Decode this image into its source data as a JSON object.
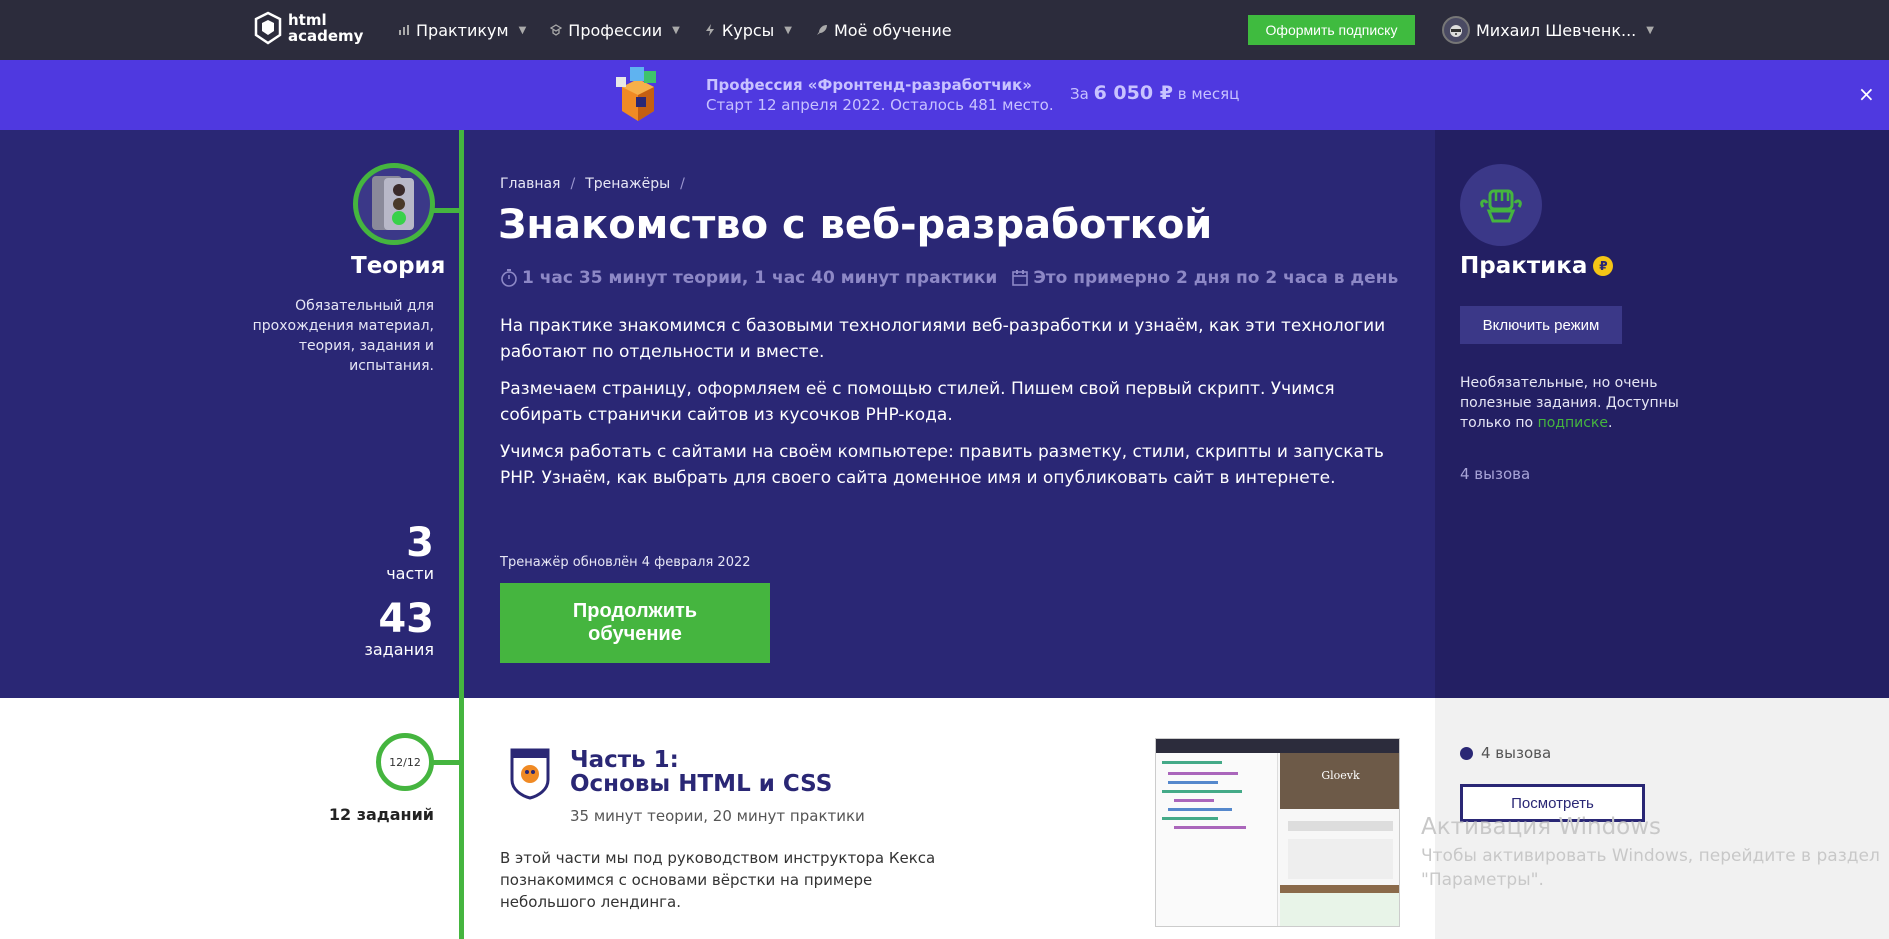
{
  "nav": {
    "logo_line1": "html",
    "logo_line2": "academy",
    "items": [
      {
        "label": "Практикум",
        "icon": "chart-icon",
        "caret": true
      },
      {
        "label": "Профессии",
        "icon": "cap-icon",
        "caret": true
      },
      {
        "label": "Курсы",
        "icon": "bolt-icon",
        "caret": true
      },
      {
        "label": "Моё обучение",
        "icon": "rocket-icon",
        "caret": false
      }
    ],
    "subscribe_label": "Оформить подписку",
    "user_name": "Михаил Шевченк..."
  },
  "promo": {
    "title": "Профессия «Фронтенд-разработчик»",
    "subtitle": "Старт 12 апреля 2022. Осталось 481 место.",
    "price_prefix": "За",
    "price": "6 050 ₽",
    "price_suffix": "в месяц",
    "close": "×"
  },
  "theory": {
    "title": "Теория",
    "desc": "Обязательный для прохождения материал, теория, задания и испытания.",
    "parts_num": "3",
    "parts_label": "части",
    "tasks_num": "43",
    "tasks_label": "задания"
  },
  "breadcrumb": {
    "home": "Главная",
    "trainers": "Тренажёры",
    "sep": "/"
  },
  "course": {
    "title": "Знакомство с веб-разработкой",
    "meta_time": "1 час 35 минут теории, 1 час 40 минут практики",
    "meta_days": "Это примерно 2 дня по 2 часа в день",
    "p1": "На практике знакомимся с базовыми технологиями веб-разработки и узнаём, как эти технологии работают по отдельности и вместе.",
    "p2": "Размечаем страницу, оформляем её с помощью стилей. Пишем свой первый скрипт. Учимся собирать странички сайтов из кусочков PHP-кода.",
    "p3": "Учимся работать с сайтами на своём компьютере: править разметку, стили, скрипты и запускать PHP. Узнаём, как выбрать для своего сайта доменное имя и опубликовать сайт в интернете.",
    "updated": "Тренажёр обновлён 4 февраля 2022",
    "continue_line1": "Продолжить",
    "continue_line2": "обучение"
  },
  "practice": {
    "title": "Практика",
    "ruble": "₽",
    "mode_label": "Включить режим",
    "desc_before": "Необязательные, но очень полезные задания. Доступны только по ",
    "desc_link": "подписке",
    "desc_after": ".",
    "count": "4 вызова"
  },
  "part1": {
    "progress": "12/12",
    "tasks": "12 заданий",
    "title_line1": "Часть 1:",
    "title_line2": "Основы HTML и CSS",
    "meta": "35 минут теории, 20 минут практики",
    "desc": "В этой части мы под руководством инструктора Кекса познакомимся с основами вёрстки на примере небольшого лендинга.",
    "challenges": "4 вызова",
    "view_label": "Посмотреть",
    "preview_title": "Gloevk"
  },
  "watermark": {
    "line1": "Активация Windows",
    "line2": "Чтобы активировать Windows, перейдите в раздел",
    "line3": "\"Параметры\"."
  },
  "colors": {
    "accent_green": "#45b53f",
    "hero_bg": "#2a2775",
    "promo_bg": "#4f39e0",
    "nav_bg": "#2c2c3c"
  }
}
